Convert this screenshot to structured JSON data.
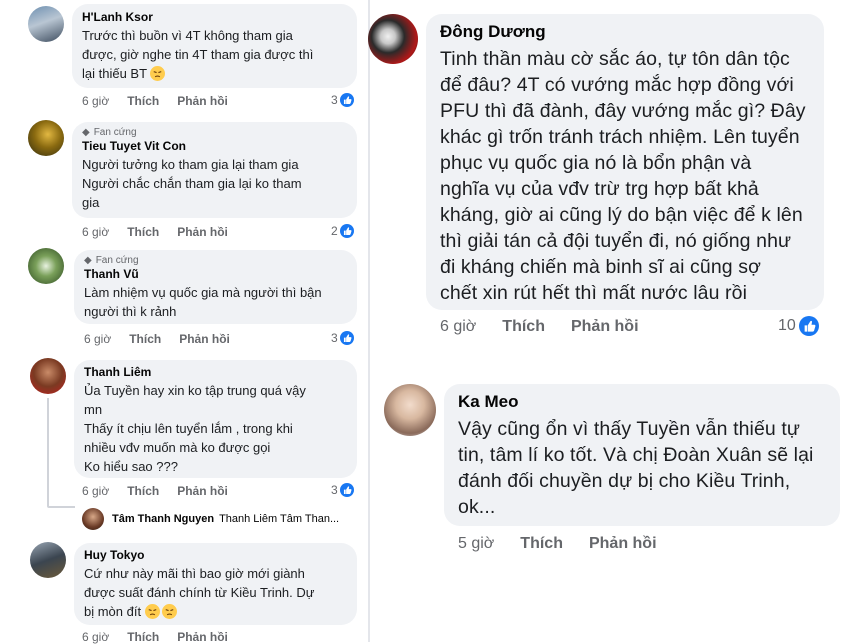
{
  "comments_left": [
    {
      "author": "H'Lanh Ksor",
      "badge": "",
      "text": [
        "Trước thì buồn vì 4T không tham gia",
        "được, giờ nghe tin 4T tham gia được thì",
        "lại thiếu BT"
      ],
      "time": "6 giờ",
      "like": "Thích",
      "reply": "Phản hồi",
      "reactions": "3"
    },
    {
      "author": "Tieu Tuyet Vit Con",
      "badge": "Fan cứng",
      "text": [
        "Người tưởng ko tham gia lại tham gia",
        "Người chắc chắn tham gia lại ko tham",
        "gia"
      ],
      "time": "6 giờ",
      "like": "Thích",
      "reply": "Phản hồi",
      "reactions": "2"
    },
    {
      "author": "Thanh Vũ",
      "badge": "Fan cứng",
      "text": [
        "Làm nhiệm vụ quốc gia mà người thì bận",
        "người thì k rảnh"
      ],
      "time": "6 giờ",
      "like": "Thích",
      "reply": "Phản hồi",
      "reactions": "3"
    },
    {
      "author": "Thanh Liêm",
      "badge": "",
      "text": [
        "Ủa Tuyền hay xin ko tập trung quá vậy",
        "mn",
        "Thấy ít chịu lên tuyển lắm , trong khi",
        "nhiều vđv muốn mà ko được gọi",
        "Ko hiểu sao ???"
      ],
      "time": "6 giờ",
      "like": "Thích",
      "reply": "Phản hồi",
      "reactions": "3",
      "reply_preview": {
        "author": "Tâm Thanh Nguyen",
        "text": "Thanh Liêm Tâm Than..."
      }
    },
    {
      "author": "Huy Tokyo",
      "badge": "",
      "text": [
        "Cứ như này mãi thì bao giờ mới giành",
        "được suất đánh chính từ Kiều Trinh. Dự",
        "bị mòn đít"
      ],
      "time": "6 giờ",
      "like": "Thích",
      "reply": "Phản hồi",
      "reactions": ""
    }
  ],
  "comments_right": [
    {
      "author": "Đông Dương",
      "text": [
        "Tinh thần màu cờ sắc áo, tự tôn dân tộc",
        "để đâu? 4T có vướng mắc hợp đồng với",
        "PFU thì đã đành, đây vướng mắc gì? Đây",
        "khác gì trốn tránh trách nhiệm. Lên tuyển",
        "phục vụ quốc gia nó là bổn phận và",
        "nghĩa vụ của vđv trừ trg hợp bất khả",
        "kháng, giờ ai cũng lý do bận việc để k lên",
        "thì giải tán cả đội tuyển đi, nó giống như",
        "đi kháng chiến mà binh sĩ ai cũng sợ",
        "chết xin rút hết thì mất nước lâu rồi"
      ],
      "time": "6 giờ",
      "like": "Thích",
      "reply": "Phản hồi",
      "reactions": "10"
    },
    {
      "author": "Ka Meo",
      "text": [
        "Vậy cũng ổn vì thấy Tuyền vẫn thiếu tự",
        "tin, tâm lí ko tốt. Và chị Đoàn Xuân sẽ lại",
        "đánh đối chuyền dự bị cho Kiều Trinh,",
        "ok..."
      ],
      "time": "5 giờ",
      "like": "Thích",
      "reply": "Phản hồi",
      "reactions": ""
    }
  ],
  "colors": {
    "bubble": "#f0f2f5",
    "like_blue": "#1877f2",
    "meta_gray": "#65676b"
  },
  "icons": {
    "like": "thumbs-up-icon",
    "fan_badge": "diamond-icon",
    "emoji": "pensive-face-icon"
  }
}
